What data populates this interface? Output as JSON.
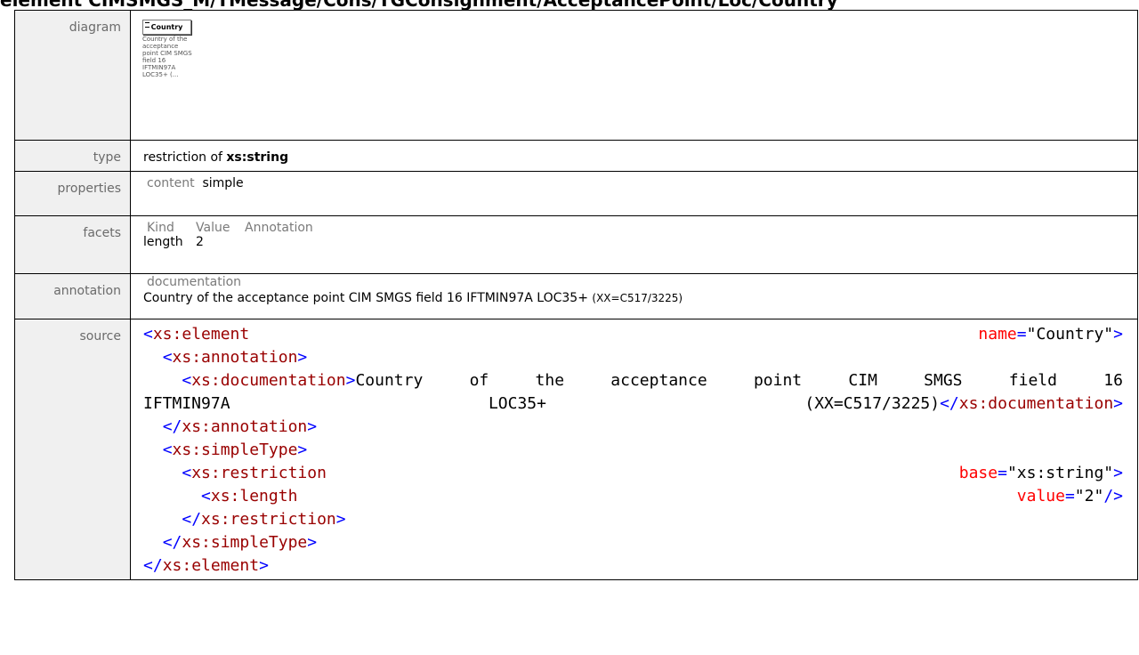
{
  "heading": "element CIMSMGS_M/TMessage/Cons/TGConsignment/AcceptancePoint/Loc/Country",
  "labels": {
    "diagram": "diagram",
    "type": "type",
    "properties": "properties",
    "facets": "facets",
    "annotation": "annotation",
    "source": "source"
  },
  "diagram": {
    "box_label": "Country",
    "doc_text": "Country of the acceptance point CIM SMGS field 16 IFTMIN97A LOC35+ (..."
  },
  "type": {
    "prefix": "restriction of",
    "base": "xs:string"
  },
  "properties": {
    "key": "content",
    "value": "simple"
  },
  "facets": {
    "headers": [
      "Kind",
      "Value",
      "Annotation"
    ],
    "rows": [
      [
        "length",
        "2",
        ""
      ]
    ]
  },
  "annotation": {
    "header": "documentation",
    "text": "Country of the acceptance point CIM SMGS field 16 IFTMIN97A LOC35+",
    "tail": "(XX=C517/3225)"
  },
  "source": {
    "l1_tag": "xs:element",
    "l1_attr": "name",
    "l1_val": "\"Country\"",
    "l2_tag": "xs:annotation",
    "l3_tag": "xs:documentation",
    "doc_words1": [
      "Country",
      "of",
      "the",
      "acceptance",
      "point",
      "CIM",
      "SMGS",
      "field",
      "16"
    ],
    "doc_w1": "IFTMIN97A",
    "doc_w2": "LOC35+",
    "doc_w3": "(XX=C517/3225)",
    "l3_close": "xs:documentation",
    "l4_close": "xs:annotation",
    "l5_tag": "xs:simpleType",
    "l6_tag": "xs:restriction",
    "l6_attr": "base",
    "l6_val": "\"xs:string\"",
    "l7_tag": "xs:length",
    "l7_attr": "value",
    "l7_val": "\"2\"",
    "l8_close": "xs:restriction",
    "l9_close": "xs:simpleType",
    "l10_close": "xs:element"
  }
}
